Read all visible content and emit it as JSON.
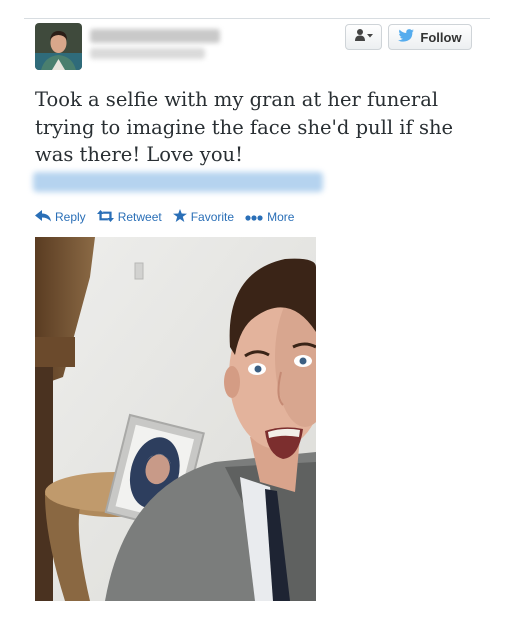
{
  "header": {
    "follow_label": "Follow",
    "user_menu_icon": "person-icon",
    "follow_icon": "twitter-bird-icon"
  },
  "tweet": {
    "text": "Took a selfie with my gran at her funeral trying to imagine the face she'd pull if she was there! Love you!"
  },
  "actions": [
    {
      "label": "Reply",
      "icon": "reply-arrow-icon"
    },
    {
      "label": "Retweet",
      "icon": "retweet-icon"
    },
    {
      "label": "Favorite",
      "icon": "star-icon"
    },
    {
      "label": "More",
      "icon": "more-dots-icon"
    }
  ],
  "colors": {
    "link": "#2a6fb7",
    "text": "#292f33",
    "follow_bird": "#55acee"
  }
}
